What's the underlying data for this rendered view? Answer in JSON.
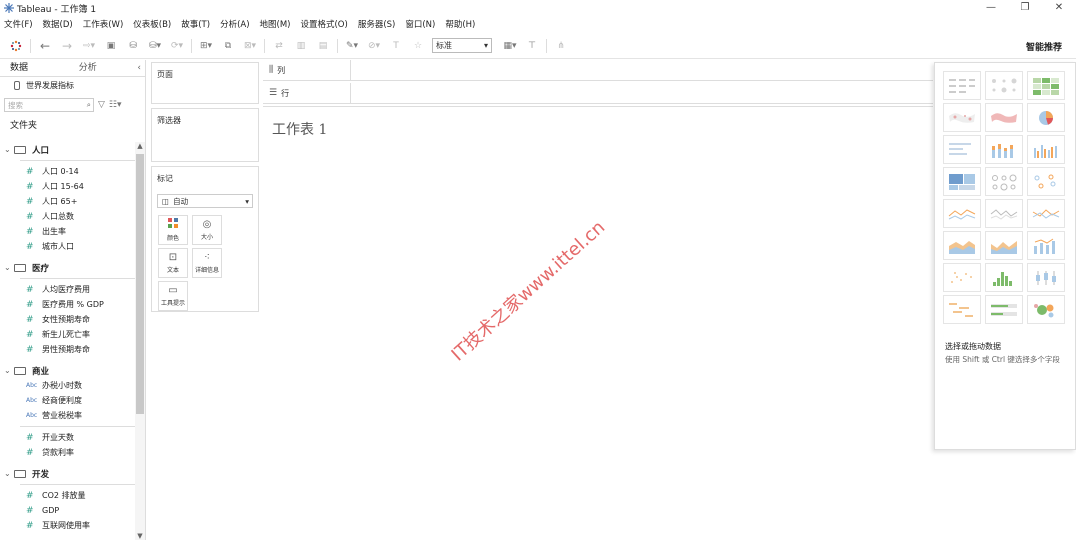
{
  "window": {
    "title": "Tableau - 工作簿 1",
    "minimize": "—",
    "maximize": "❐",
    "close": "✕"
  },
  "menu": [
    "文件(F)",
    "数据(D)",
    "工作表(W)",
    "仪表板(B)",
    "故事(T)",
    "分析(A)",
    "地图(M)",
    "设置格式(O)",
    "服务器(S)",
    "窗口(N)",
    "帮助(H)"
  ],
  "toolbar": {
    "fit_value": "标准",
    "show_me_label": "智能推荐"
  },
  "data_pane": {
    "tabs": [
      "数据",
      "分析"
    ],
    "datasource": "世界发展指标",
    "search_placeholder": "搜索",
    "folder_heading": "文件夹",
    "groups": [
      {
        "name": "人口",
        "fields": [
          {
            "type": "#",
            "name": "人口 0-14"
          },
          {
            "type": "#",
            "name": "人口 15-64"
          },
          {
            "type": "#",
            "name": "人口 65+"
          },
          {
            "type": "#",
            "name": "人口总数"
          },
          {
            "type": "#",
            "name": "出生率"
          },
          {
            "type": "#",
            "name": "城市人口"
          }
        ]
      },
      {
        "name": "医疗",
        "fields": [
          {
            "type": "#",
            "name": "人均医疗费用"
          },
          {
            "type": "#",
            "name": "医疗费用 % GDP"
          },
          {
            "type": "#",
            "name": "女性预期寿命"
          },
          {
            "type": "#",
            "name": "新生儿死亡率"
          },
          {
            "type": "#",
            "name": "男性预期寿命"
          }
        ]
      },
      {
        "name": "商业",
        "fields": [
          {
            "type": "Abc",
            "name": "办税小时数"
          },
          {
            "type": "Abc",
            "name": "经商便利度"
          },
          {
            "type": "Abc",
            "name": "营业税税率"
          },
          {
            "type": "#",
            "name": "开业天数"
          },
          {
            "type": "#",
            "name": "贷款利率"
          }
        ]
      },
      {
        "name": "开发",
        "fields": [
          {
            "type": "#",
            "name": "CO2 排放量"
          },
          {
            "type": "#",
            "name": "GDP"
          },
          {
            "type": "#",
            "name": "互联网使用率"
          }
        ]
      }
    ]
  },
  "cards": {
    "pages": "页面",
    "filters": "筛选器",
    "marks": "标记",
    "mark_type": "自动",
    "mark_buttons": [
      "颜色",
      "大小",
      "文本",
      "详细信息",
      "工具提示"
    ]
  },
  "shelves": {
    "columns": "列",
    "rows": "行"
  },
  "canvas": {
    "sheet_title": "工作表 1",
    "watermark": "IT技术之家www.ittel.cn"
  },
  "show_me": {
    "hint_title": "选择或拖动数据",
    "hint_text": "使用 Shift 或 Ctrl 键选择多个字段"
  }
}
